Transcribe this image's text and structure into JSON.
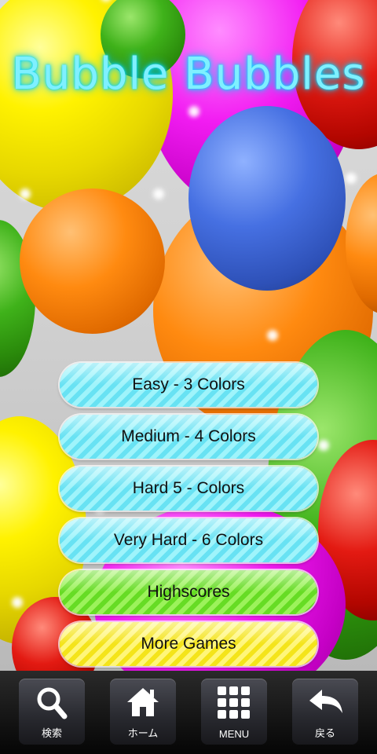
{
  "game": {
    "title": "Bubble Bubbles"
  },
  "menu": {
    "easy": "Easy - 3 Colors",
    "medium": "Medium - 4 Colors",
    "hard": "Hard 5 - Colors",
    "very_hard": "Very Hard - 6 Colors",
    "highscores": "Highscores",
    "more_games": "More Games"
  },
  "navbar": {
    "search": {
      "label": "検索",
      "icon": "search-icon"
    },
    "home": {
      "label": "ホーム",
      "icon": "home-icon"
    },
    "menu": {
      "label": "MENU",
      "icon": "grid-icon"
    },
    "back": {
      "label": "戻る",
      "icon": "back-arrow-icon"
    }
  },
  "colors": {
    "title": "#7ff0ff",
    "difficulty_buttons": "#68e2f3",
    "highscores": "#66dc24",
    "more_games": "#f4e41a"
  }
}
